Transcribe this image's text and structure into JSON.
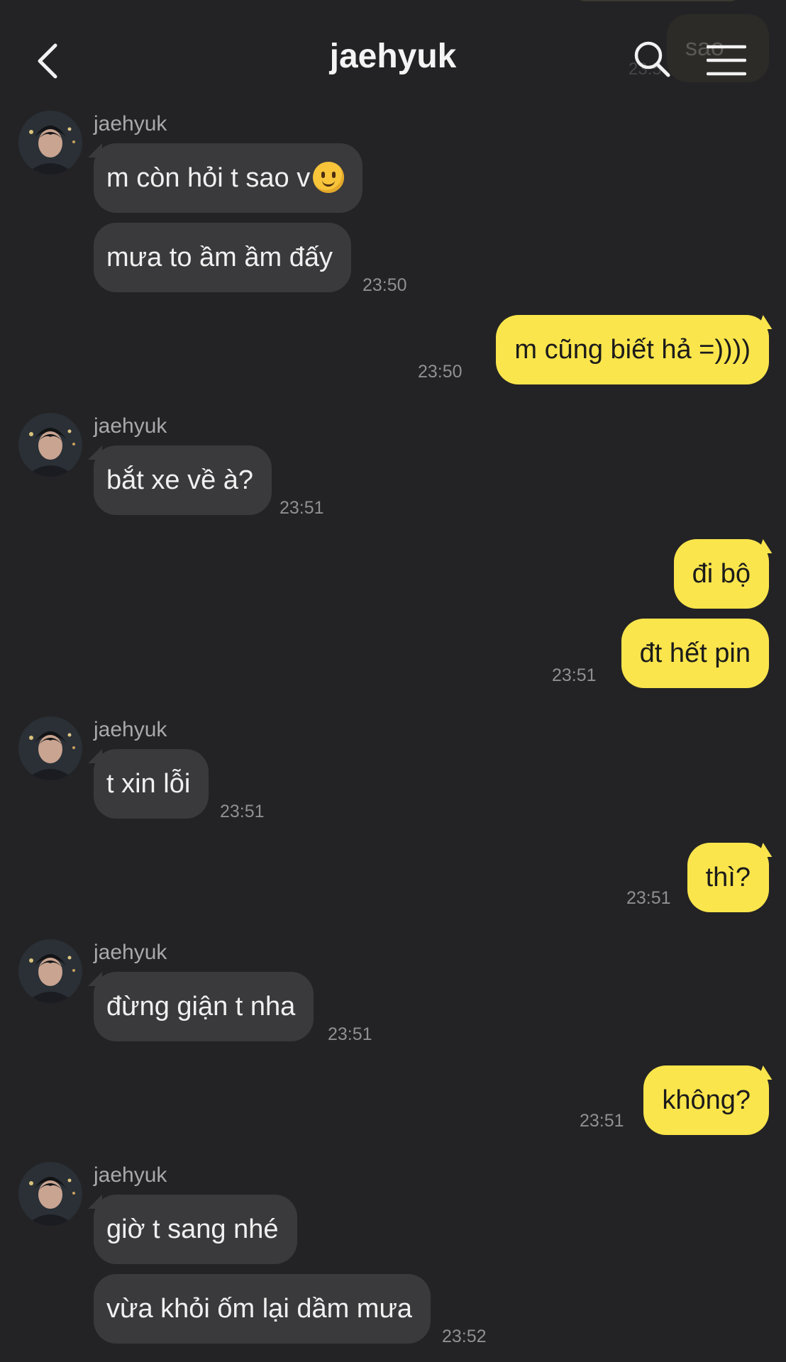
{
  "header": {
    "title": "jaehyuk",
    "back_icon": "chevron-left-icon",
    "search_icon": "search-icon",
    "menu_icon": "hamburger-menu-icon"
  },
  "ghost": {
    "text": "sao",
    "time": "23:5"
  },
  "colors": {
    "background": "#232325",
    "incoming_bubble": "#3a3a3c",
    "outgoing_bubble": "#fae54c"
  },
  "messages": [
    {
      "dir": "in",
      "sender": "jaehyuk",
      "text": "m còn hỏi t sao v",
      "emoji": "slightly-smiling-face-emoji"
    },
    {
      "dir": "in",
      "text": "mưa to ầm ầm đấy",
      "time": "23:50"
    },
    {
      "dir": "out",
      "text": "m cũng biết hả =))))",
      "time": "23:50"
    },
    {
      "dir": "in",
      "sender": "jaehyuk",
      "text": "bắt xe về à?",
      "time": "23:51"
    },
    {
      "dir": "out",
      "text": "đi bộ"
    },
    {
      "dir": "out",
      "text": "đt hết pin",
      "time": "23:51"
    },
    {
      "dir": "in",
      "sender": "jaehyuk",
      "text": "t xin lỗi",
      "time": "23:51"
    },
    {
      "dir": "out",
      "text": "thì?",
      "time": "23:51"
    },
    {
      "dir": "in",
      "sender": "jaehyuk",
      "text": "đừng giận t nha",
      "time": "23:51"
    },
    {
      "dir": "out",
      "text": "không?",
      "time": "23:51"
    },
    {
      "dir": "in",
      "sender": "jaehyuk",
      "text": "giờ t sang nhé"
    },
    {
      "dir": "in",
      "text": "vừa khỏi ốm lại dầm mưa",
      "time": "23:52"
    }
  ]
}
